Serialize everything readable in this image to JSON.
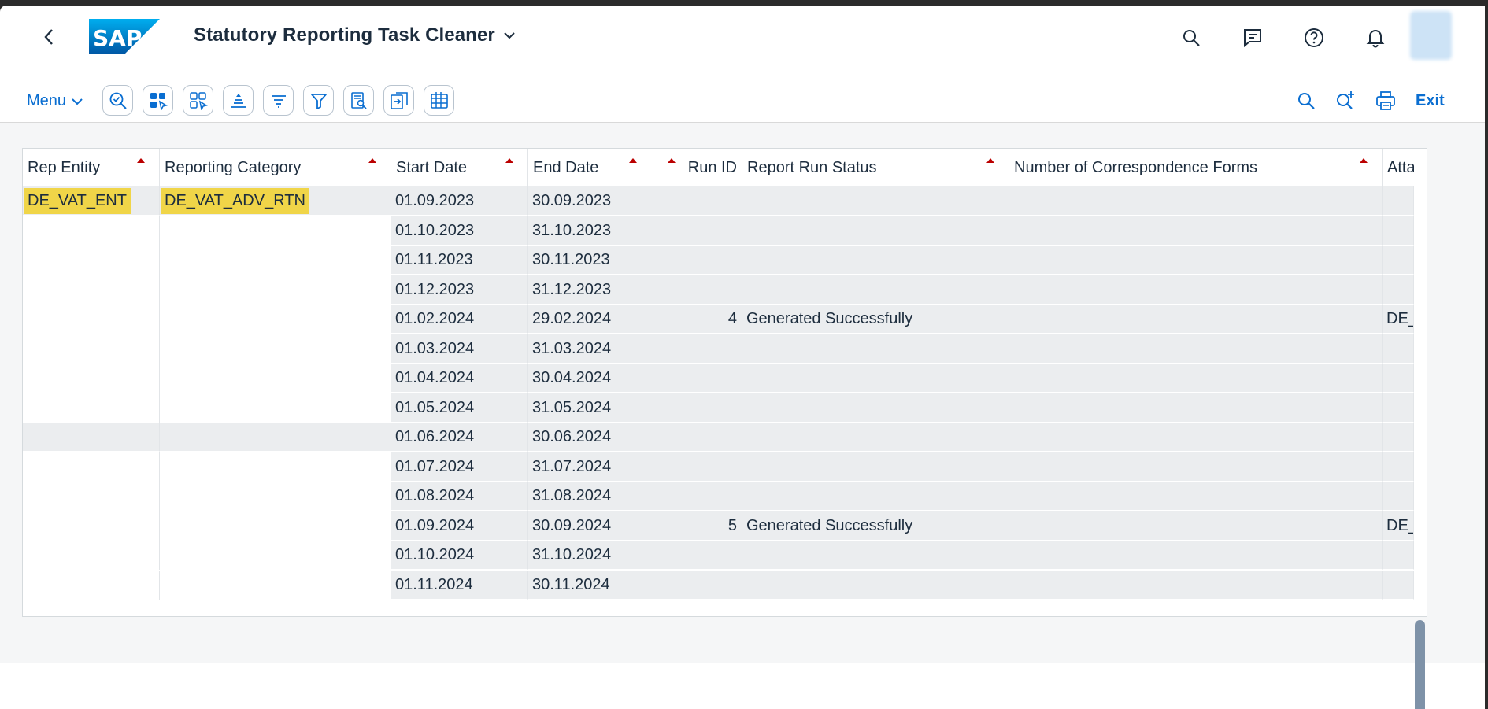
{
  "shell": {
    "title": "Statutory Reporting Task Cleaner",
    "logo_text": "SAP",
    "brand_color": "#0a6ed1"
  },
  "toolbar": {
    "menu_label": "Menu",
    "exit_label": "Exit",
    "buttons": [
      "zoom-check-icon",
      "layout-select-icon",
      "layout-deselect-icon",
      "align-icon",
      "sort-icon",
      "filter-icon",
      "find-list-icon",
      "export-icon",
      "table-settings-icon"
    ],
    "right_icons": [
      "search-icon",
      "search-next-icon",
      "print-icon"
    ]
  },
  "table": {
    "headers": {
      "rep_entity": "Rep Entity",
      "reporting_category": "Reporting Category",
      "start_date": "Start Date",
      "end_date": "End Date",
      "run_id": "Run ID",
      "report_run_status": "Report Run Status",
      "num_forms": "Number of Correspondence Forms",
      "att": "Atta"
    },
    "group": {
      "rep_entity": "DE_VAT_ENT",
      "reporting_category": "DE_VAT_ADV_RTN"
    },
    "rows": [
      {
        "start": "01.09.2023",
        "end": "30.09.2023",
        "run_id": "",
        "status": "",
        "att": ""
      },
      {
        "start": "01.10.2023",
        "end": "31.10.2023",
        "run_id": "",
        "status": "",
        "att": ""
      },
      {
        "start": "01.11.2023",
        "end": "30.11.2023",
        "run_id": "",
        "status": "",
        "att": ""
      },
      {
        "start": "01.12.2023",
        "end": "31.12.2023",
        "run_id": "",
        "status": "",
        "att": ""
      },
      {
        "start": "01.02.2024",
        "end": "29.02.2024",
        "run_id": "4",
        "status": "Generated Successfully",
        "att": "DE_"
      },
      {
        "start": "01.03.2024",
        "end": "31.03.2024",
        "run_id": "",
        "status": "",
        "att": ""
      },
      {
        "start": "01.04.2024",
        "end": "30.04.2024",
        "run_id": "",
        "status": "",
        "att": ""
      },
      {
        "start": "01.05.2024",
        "end": "31.05.2024",
        "run_id": "",
        "status": "",
        "att": ""
      },
      {
        "start": "01.06.2024",
        "end": "30.06.2024",
        "run_id": "",
        "status": "",
        "att": ""
      },
      {
        "start": "01.07.2024",
        "end": "31.07.2024",
        "run_id": "",
        "status": "",
        "att": ""
      },
      {
        "start": "01.08.2024",
        "end": "31.08.2024",
        "run_id": "",
        "status": "",
        "att": ""
      },
      {
        "start": "01.09.2024",
        "end": "30.09.2024",
        "run_id": "5",
        "status": "Generated Successfully",
        "att": "DE_"
      },
      {
        "start": "01.10.2024",
        "end": "31.10.2024",
        "run_id": "",
        "status": "",
        "att": ""
      },
      {
        "start": "01.11.2024",
        "end": "30.11.2024",
        "run_id": "",
        "status": "",
        "att": ""
      }
    ]
  }
}
